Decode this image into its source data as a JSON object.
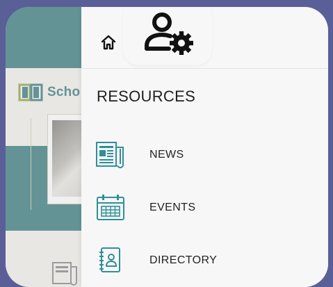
{
  "background_app": {
    "brand_text": "Scho"
  },
  "drawer": {
    "section_heading": "RESOURCES",
    "items": [
      {
        "label": "NEWS",
        "icon": "newspaper-icon"
      },
      {
        "label": "EVENTS",
        "icon": "calendar-icon"
      },
      {
        "label": "DIRECTORY",
        "icon": "address-book-icon"
      }
    ]
  },
  "colors": {
    "primary": "#1e6a6f",
    "icon_accent": "#2e8f9a",
    "backdrop": "#5a5f97"
  }
}
